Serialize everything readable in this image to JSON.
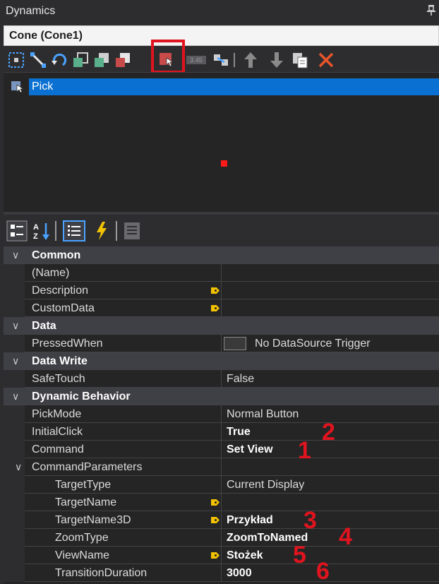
{
  "panel": {
    "title": "Dynamics",
    "pin_icon": "pin-icon"
  },
  "object": {
    "name": "Cone (Cone1)"
  },
  "toolbar": {
    "icons": [
      "select-area-icon",
      "resize-icon",
      "rotate-icon",
      "move-front-icon",
      "move-back-icon",
      "pick-icon",
      "value-display-icon",
      "link-icon",
      "move-up-icon",
      "move-down-icon",
      "copy-icon",
      "delete-icon"
    ],
    "value_display_label": "3.45",
    "highlight_color": "#e0141e"
  },
  "animations": [
    {
      "label": "Pick",
      "icon": "pick-icon",
      "selected": true
    }
  ],
  "property_tools": {
    "icons": [
      "categorized-icon",
      "alphabetical-icon",
      "properties-icon",
      "events-icon",
      "property-pages-icon"
    ]
  },
  "properties": {
    "categories": [
      {
        "name": "Common",
        "items": [
          {
            "name": "(Name)",
            "value": "",
            "bold": false
          },
          {
            "name": "Description",
            "value": "",
            "tag": true
          },
          {
            "name": "CustomData",
            "value": "",
            "tag": true
          }
        ]
      },
      {
        "name": "Data",
        "items": [
          {
            "name": "PressedWhen",
            "value": "No DataSource Trigger",
            "swatch": true
          }
        ]
      },
      {
        "name": "Data Write",
        "items": [
          {
            "name": "SafeTouch",
            "value": "False"
          }
        ]
      },
      {
        "name": "Dynamic Behavior",
        "items": [
          {
            "name": "PickMode",
            "value": "Normal Button"
          },
          {
            "name": "InitialClick",
            "value": "True",
            "bold": true
          },
          {
            "name": "Command",
            "value": "Set View",
            "bold": true
          },
          {
            "name": "CommandParameters",
            "value": "",
            "expandable": true,
            "children": [
              {
                "name": "TargetType",
                "value": "Current Display"
              },
              {
                "name": "TargetName",
                "value": "",
                "tag": true
              },
              {
                "name": "TargetName3D",
                "value": "Przykład",
                "tag": true,
                "bold": true
              },
              {
                "name": "ZoomType",
                "value": "ZoomToNamed",
                "bold": true
              },
              {
                "name": "ViewName",
                "value": "Stożek",
                "tag": true,
                "bold": true
              },
              {
                "name": "TransitionDuration",
                "value": "3000",
                "bold": true
              }
            ]
          }
        ]
      }
    ]
  },
  "annotations": [
    "2",
    "1",
    "3",
    "4",
    "5",
    "6"
  ],
  "colors": {
    "selection": "#0a70d1",
    "annotation": "#e0141e",
    "tag": "#f2c200"
  }
}
